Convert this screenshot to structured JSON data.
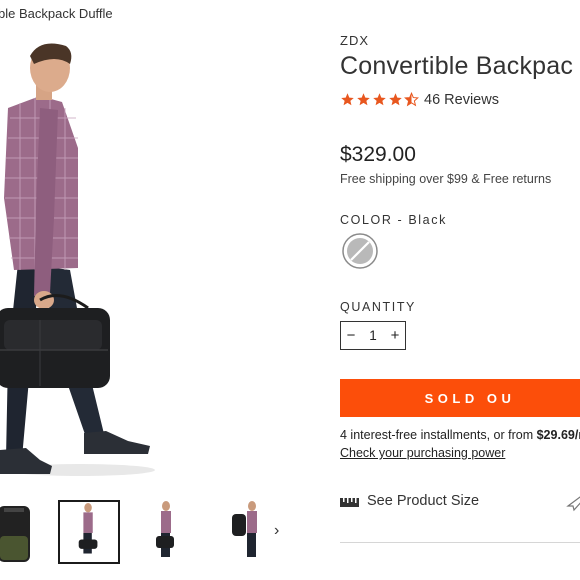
{
  "caption": "ble Backpack Duffle",
  "product": {
    "brand": "ZDX",
    "title": "Convertible Backpac",
    "rating": 4.5,
    "reviews_label": "46 Reviews",
    "price": "$329.00",
    "shipping": "Free shipping over $99 & Free returns"
  },
  "color": {
    "label": "COLOR - Black"
  },
  "quantity": {
    "label": "QUANTITY",
    "value": "1",
    "minus": "−",
    "plus": "+"
  },
  "cta": {
    "label": "SOLD OU"
  },
  "installments": {
    "prefix": "4 interest-free installments, or from ",
    "amount": "$29.69/m",
    "link": "Check your purchasing power"
  },
  "size": {
    "label": "See Product Size"
  },
  "thumbs": {
    "next": "›"
  },
  "colors": {
    "accent": "#fc4e0a",
    "star": "#e8571f"
  }
}
